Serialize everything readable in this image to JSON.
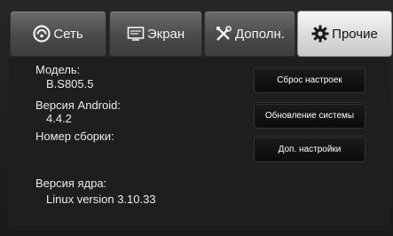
{
  "tabs": [
    {
      "label": "Сеть",
      "icon": "network-icon"
    },
    {
      "label": "Экран",
      "icon": "display-icon"
    },
    {
      "label": "Дополн.",
      "icon": "tools-icon"
    },
    {
      "label": "Прочие",
      "icon": "gear-icon",
      "active": true
    }
  ],
  "info": {
    "model_label": "Модель:",
    "model_value": "B.S805.5",
    "android_label": "Версия Android:",
    "android_value": "4.4.2",
    "build_label": "Номер сборки:",
    "kernel_label": "Версия ядра:",
    "kernel_value": "Linux version 3.10.33"
  },
  "buttons": {
    "reset": "Сброс настроек",
    "update": "Обновление системы",
    "more": "Доп. настройки"
  },
  "colors": {
    "background": "#1c1c1c",
    "tab_inactive": "#4a4a4a",
    "tab_active": "#e0e0e0",
    "button": "#111111"
  }
}
